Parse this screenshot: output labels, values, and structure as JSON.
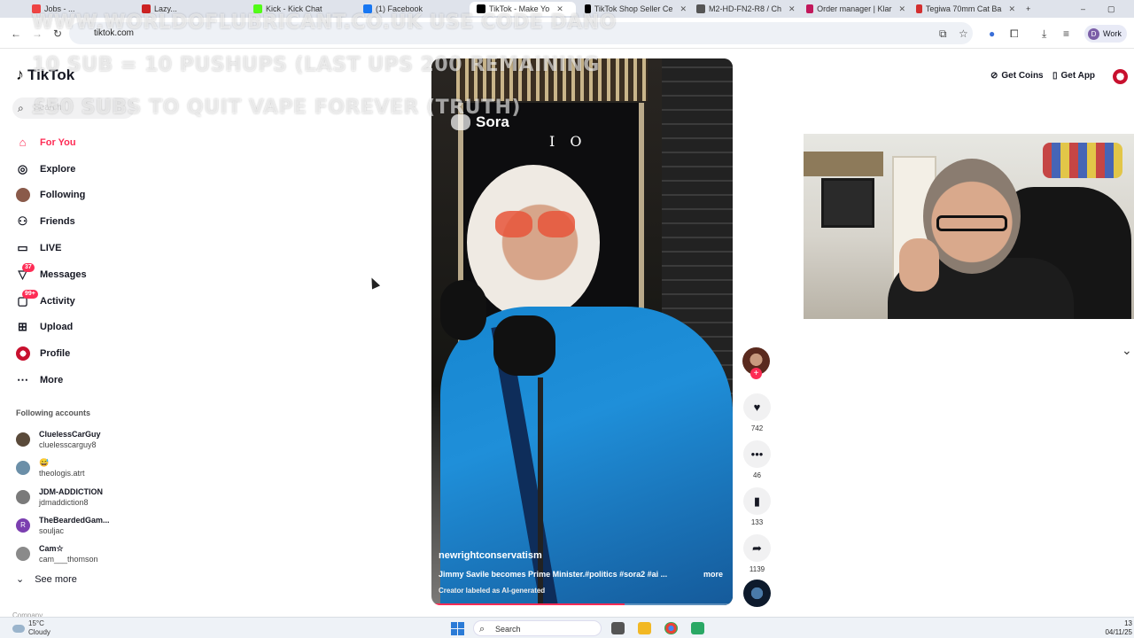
{
  "browser": {
    "tabs": [
      {
        "label": "Jobs - ...",
        "color": "#e44"
      },
      {
        "label": "Lazy...",
        "color": "#c22"
      },
      {
        "label": "Kick - Kick Chat",
        "color": "#53fc18"
      },
      {
        "label": "(1) Facebook",
        "color": "#1877f2"
      },
      {
        "label": "TikTok - Make Yo",
        "color": "#000",
        "active": true
      },
      {
        "label": "TikTok Shop Seller Ce",
        "color": "#000"
      },
      {
        "label": "M2-HD-FN2-R8 / Ch",
        "color": "#555"
      },
      {
        "label": "Order manager | Klar",
        "color": "#c2185b"
      },
      {
        "label": "Tegiwa 70mm Cat Ba",
        "color": "#d32f2f"
      }
    ],
    "url": "tiktok.com",
    "profile_label": "Work",
    "profile_initial": "D"
  },
  "overlay_lines": [
    "WWW.WORLDOFLUBRICANT.CO.UK USE CODE DANO",
    "10 SUB = 10 PUSHUPS (LAST UPS 200 REMAINING",
    "£50 SUBS TO QUIT VAPE FOREVER (TRUTH)"
  ],
  "sidebar": {
    "logo_text": "TikTok",
    "search_placeholder": "Search",
    "nav": [
      {
        "label": "For You",
        "icon": "home-icon",
        "glyph": "⌂",
        "active": true
      },
      {
        "label": "Explore",
        "icon": "compass-icon",
        "glyph": "◎"
      },
      {
        "label": "Following",
        "icon": "following-avatar-icon",
        "glyph": "●"
      },
      {
        "label": "Friends",
        "icon": "friends-icon",
        "glyph": "👥"
      },
      {
        "label": "LIVE",
        "icon": "live-icon",
        "glyph": "▭"
      },
      {
        "label": "Messages",
        "icon": "messages-icon",
        "glyph": "▽",
        "badge": "37"
      },
      {
        "label": "Activity",
        "icon": "activity-icon",
        "glyph": "▢",
        "badge": "99+"
      },
      {
        "label": "Upload",
        "icon": "upload-icon",
        "glyph": "⊞"
      },
      {
        "label": "Profile",
        "icon": "profile-icon",
        "glyph": "◉"
      },
      {
        "label": "More",
        "icon": "more-icon",
        "glyph": "⋯"
      }
    ],
    "following_title": "Following accounts",
    "following": [
      {
        "name": "CluelessCarGuy",
        "handle": "cluelesscarguy8",
        "color": "#5a4a3a"
      },
      {
        "name": "😅",
        "handle": "theologis.atrt",
        "color": "#6b8fa8"
      },
      {
        "name": "JDM-ADDICTION",
        "handle": "jdmaddiction8",
        "color": "#7a7a7a"
      },
      {
        "name": "TheBeardedGam...",
        "handle": "souljac",
        "color": "#7b3fb0"
      },
      {
        "name": "Cam☆",
        "handle": "cam___thomson",
        "color": "#8a8a8a"
      }
    ],
    "see_more": "See more",
    "company": "Company"
  },
  "video": {
    "watermark": "Sora",
    "door_number": "I O",
    "author": "newrightconservatism",
    "description": "Jimmy Savile becomes Prime Minister.#politics #sora2 #ai ...",
    "more_label": "more",
    "ai_label": "Creator labeled as AI-generated",
    "progress": 0.64
  },
  "actions": {
    "likes": "742",
    "comments": "46",
    "saves": "133",
    "shares": "1139"
  },
  "header": {
    "get_coins": "Get Coins",
    "get_app": "Get App"
  },
  "taskbar": {
    "temp": "15°C",
    "weather": "Cloudy",
    "search_label": "Search",
    "time": "13",
    "date": "04/11/25"
  }
}
